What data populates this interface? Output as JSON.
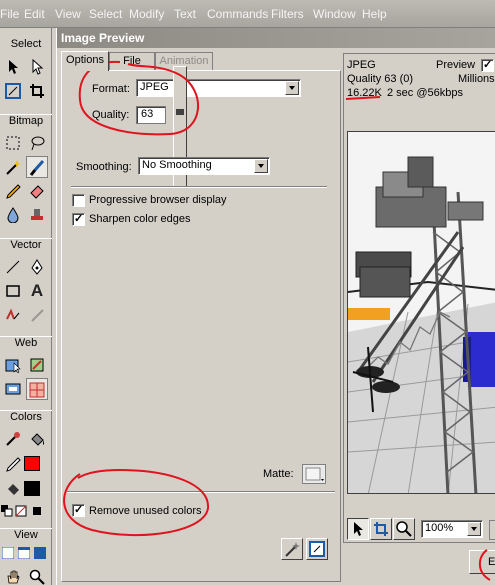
{
  "menubar": {
    "items": [
      "File",
      "Edit",
      "View",
      "Select",
      "Modify",
      "Text",
      "Commands",
      "Filters",
      "Window",
      "Help"
    ]
  },
  "tools": {
    "sections": [
      "Select",
      "Bitmap",
      "Vector",
      "Web",
      "Colors",
      "View"
    ],
    "text_tool_glyph": "A",
    "stroke_color": "#ff0000",
    "fill_color": "#000000"
  },
  "dialog": {
    "title": "Image Preview",
    "tabs": [
      "Options",
      "File",
      "Animation"
    ],
    "format": {
      "label": "Format:",
      "value": "JPEG"
    },
    "quality": {
      "label": "Quality:",
      "value": "63",
      "level": 0.63
    },
    "smoothing": {
      "label": "Smoothing:",
      "value": "No Smoothing"
    },
    "progressive_label": "Progressive browser display",
    "progressive_checked": false,
    "sharpen_label": "Sharpen color edges",
    "sharpen_checked": true,
    "matte_label": "Matte:",
    "remove_unused_label": "Remove unused colors",
    "remove_unused_checked": true
  },
  "preview": {
    "format": "JPEG",
    "preview_label": "Preview",
    "preview_checked": true,
    "quality_line": "Quality 63 (0)",
    "colors_label": "Millions",
    "size": "16.22K",
    "download": "2 sec @56kbps",
    "zoom": "100%",
    "export_btn_partial": "E"
  },
  "colors": {
    "annotation_red": "#e0141e",
    "menubar": "#bdbab3",
    "panel": "#d4d0c8",
    "orange_stripe": "#f2a020",
    "blue_box": "#2b2bd0"
  }
}
